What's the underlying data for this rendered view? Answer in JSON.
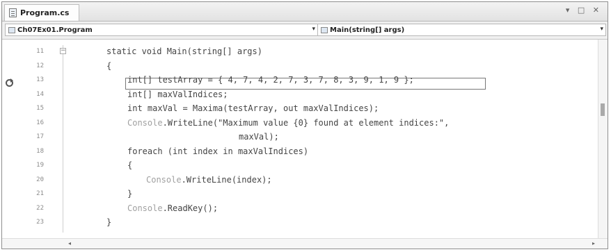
{
  "tab": {
    "title": "Program.cs",
    "icon": "cs-file-icon"
  },
  "window_controls": "▾ □ ✕",
  "navbar": {
    "left_combo": "Ch07Ex01.Program",
    "right_combo": "Main(string[] args)"
  },
  "lines": [
    {
      "num": "11",
      "code": "static void Main(string[] args)"
    },
    {
      "num": "12",
      "code": "{"
    },
    {
      "num": "13",
      "code": "int[] testArray = { 4, 7, 4, 2, 7, 3, 7, 8, 3, 9, 1, 9 };"
    },
    {
      "num": "14",
      "code": "int[] maxValIndices;"
    },
    {
      "num": "15",
      "code": "int maxVal = Maxima(testArray, out maxValIndices);"
    },
    {
      "num": "16",
      "code_console": "Console",
      "code": ".WriteLine(\"Maximum value {0} found at element indices:\","
    },
    {
      "num": "17",
      "code": "maxVal);"
    },
    {
      "num": "18",
      "code": "foreach (int index in maxValIndices)"
    },
    {
      "num": "19",
      "code": "{"
    },
    {
      "num": "20",
      "code_console": "Console",
      "code": ".WriteLine(index);"
    },
    {
      "num": "21",
      "code": "}"
    },
    {
      "num": "22",
      "code_console": "Console",
      "code": ".ReadKey();"
    },
    {
      "num": "23",
      "code": "}"
    }
  ],
  "colors": {
    "line_numbers": "#8a8a8a",
    "code": "#444444",
    "type_name": "#a0a0a0"
  }
}
